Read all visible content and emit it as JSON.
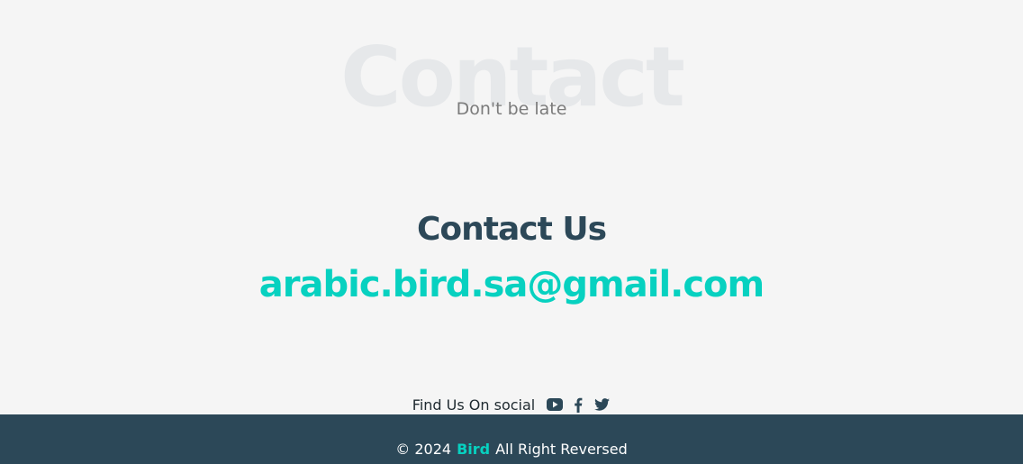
{
  "section": {
    "background_title": "Contact",
    "subtitle": "Don't be late"
  },
  "contact": {
    "title": "Contact Us",
    "email": "arabic.bird.sa@gmail.com"
  },
  "social": {
    "label": "Find Us On social",
    "icons": [
      "youtube-icon",
      "facebook-icon",
      "twitter-icon"
    ]
  },
  "footer": {
    "copyright": "© 2024",
    "brand": "Bird",
    "rights": "All Right Reversed"
  },
  "colors": {
    "background": "#f5f5f5",
    "heading": "#2c4858",
    "accent": "#07d1c0",
    "footer_bg": "#2c4858",
    "watermark": "#e6e8ea"
  }
}
